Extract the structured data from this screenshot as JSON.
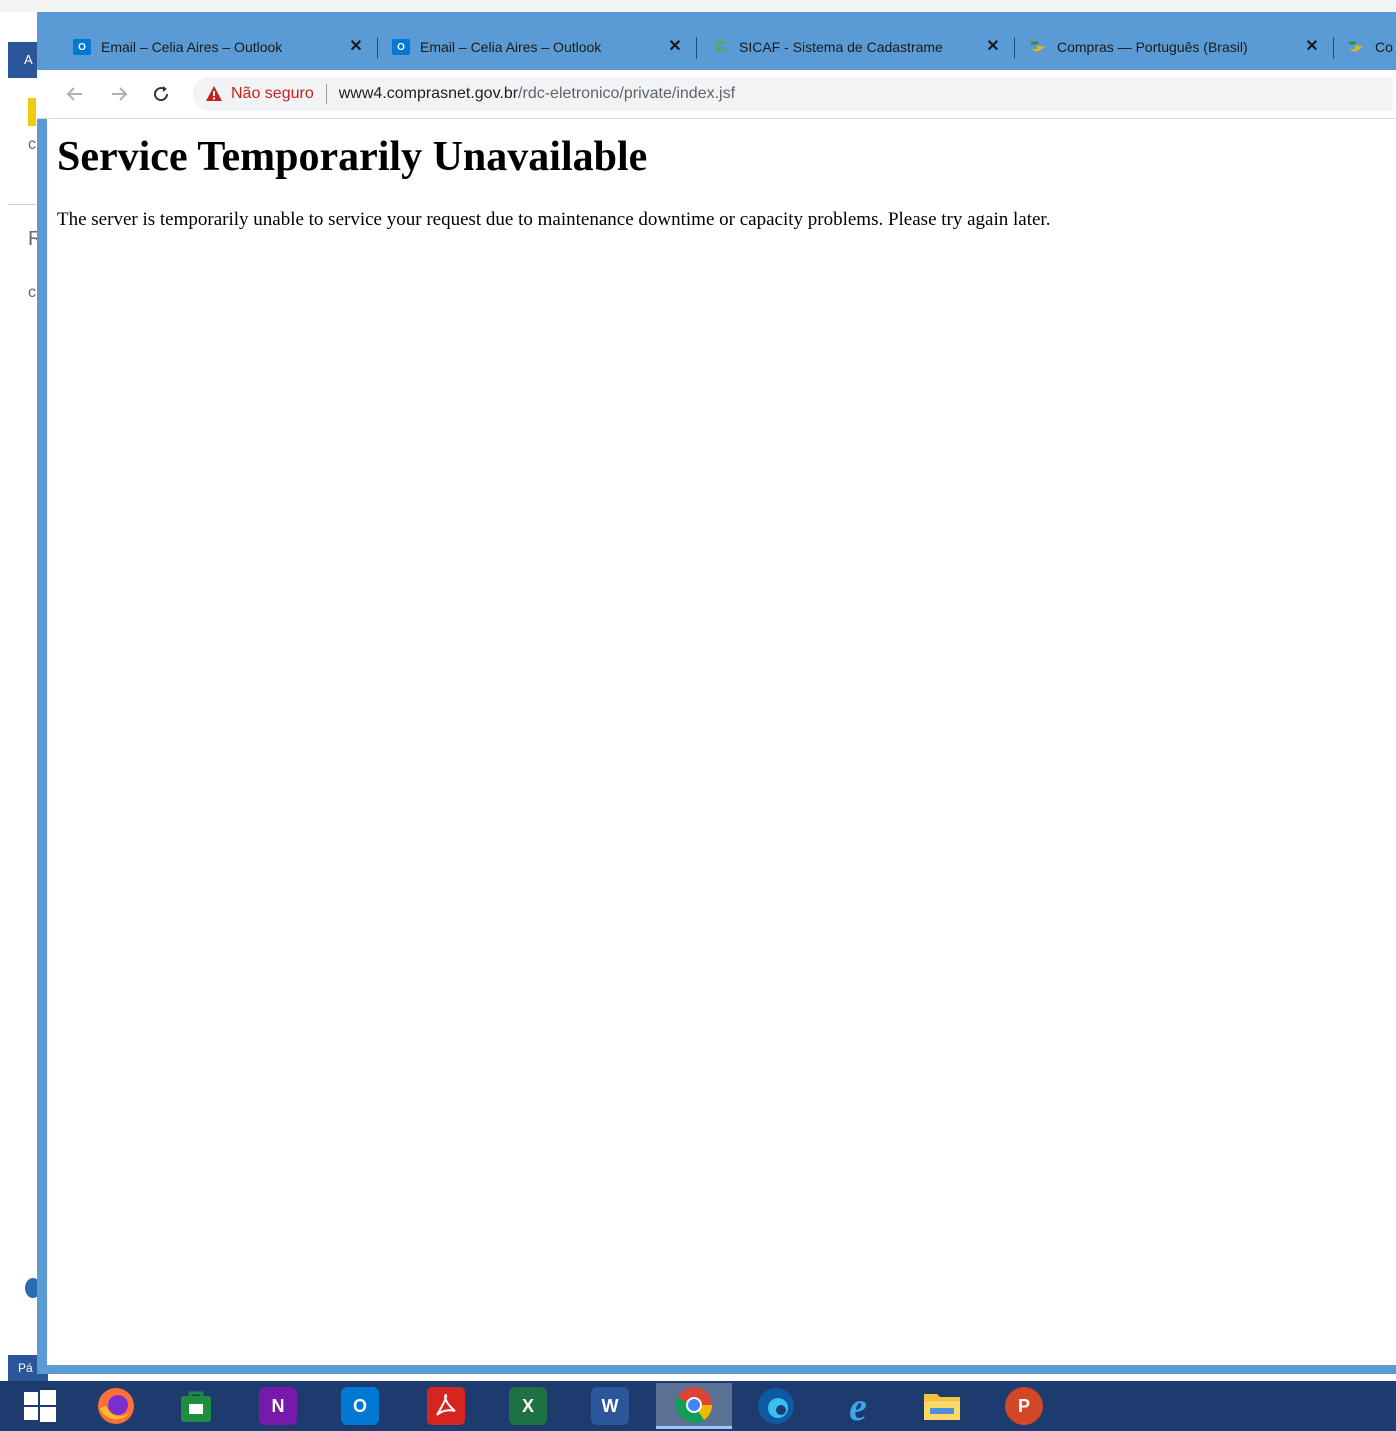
{
  "background_window": {
    "tab_letter": "A",
    "status_text": "Pá"
  },
  "browser": {
    "tabs": [
      {
        "title": "Email – Celia Aires – Outlook",
        "icon": "outlook-icon"
      },
      {
        "title": "Email – Celia Aires – Outlook",
        "icon": "outlook-icon"
      },
      {
        "title": "SICAF - Sistema de Cadastrame",
        "icon": "sicaf-icon"
      },
      {
        "title": "Compras — Português (Brasil)",
        "icon": "compras-icon"
      },
      {
        "title": "Co",
        "icon": "compras-icon"
      }
    ],
    "toolbar": {
      "security_label": "Não seguro",
      "url_host": "www4.comprasnet.gov.br",
      "url_path": "/rdc-eletronico/private/index.jsf"
    }
  },
  "page": {
    "title": "Service Temporarily Unavailable",
    "message": "The server is temporarily unable to service your request due to maintenance downtime or capacity problems. Please try again later."
  },
  "taskbar": {
    "items": [
      {
        "name": "start-button",
        "icon": "windows-logo-icon"
      },
      {
        "name": "firefox",
        "icon": "firefox-icon"
      },
      {
        "name": "store",
        "icon": "store-icon"
      },
      {
        "name": "onenote",
        "icon": "onenote-icon",
        "letter": "N"
      },
      {
        "name": "outlook",
        "icon": "outlook-icon",
        "letter": "O"
      },
      {
        "name": "acrobat",
        "icon": "acrobat-icon"
      },
      {
        "name": "excel",
        "icon": "excel-icon",
        "letter": "X"
      },
      {
        "name": "word",
        "icon": "word-icon",
        "letter": "W"
      },
      {
        "name": "chrome",
        "icon": "chrome-icon",
        "active": true
      },
      {
        "name": "edge",
        "icon": "edge-icon"
      },
      {
        "name": "internet-explorer",
        "icon": "ie-icon",
        "letter": "e"
      },
      {
        "name": "file-explorer",
        "icon": "folder-icon"
      },
      {
        "name": "powerpoint",
        "icon": "powerpoint-icon",
        "letter": "P"
      }
    ]
  },
  "colors": {
    "tabstrip": "#5b9bd5",
    "taskbar": "#1d3b6e",
    "insecure": "#c5221f",
    "outlook": "#0078d4",
    "onenote": "#7719aa",
    "acrobat": "#d4261f",
    "excel": "#1e7145",
    "word": "#2b579a",
    "powerpoint": "#d24726"
  }
}
